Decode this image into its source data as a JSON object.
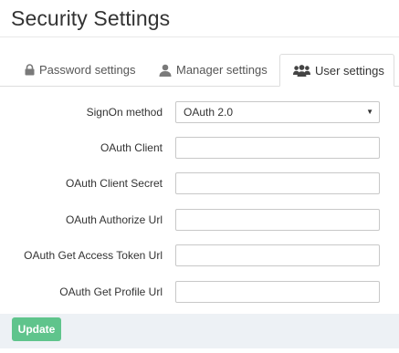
{
  "page": {
    "title": "Security Settings"
  },
  "tabs": [
    {
      "label": "Password settings",
      "icon": "lock-icon",
      "active": false
    },
    {
      "label": "Manager settings",
      "icon": "user-icon",
      "active": false
    },
    {
      "label": "User settings",
      "icon": "users-icon",
      "active": true
    }
  ],
  "form": {
    "signon_method": {
      "label": "SignOn method",
      "value": "OAuth 2.0"
    },
    "oauth_client": {
      "label": "OAuth Client",
      "value": ""
    },
    "oauth_client_secret": {
      "label": "OAuth Client Secret",
      "value": ""
    },
    "oauth_authorize_url": {
      "label": "OAuth Authorize Url",
      "value": ""
    },
    "oauth_get_access_token_url": {
      "label": "OAuth Get Access Token Url",
      "value": ""
    },
    "oauth_get_profile_url": {
      "label": "OAuth Get Profile Url",
      "value": ""
    }
  },
  "footer": {
    "update_label": "Update"
  },
  "colors": {
    "accent_button": "#5fc48c",
    "footer_background": "#edf1f5",
    "tab_border": "#dddddd"
  }
}
